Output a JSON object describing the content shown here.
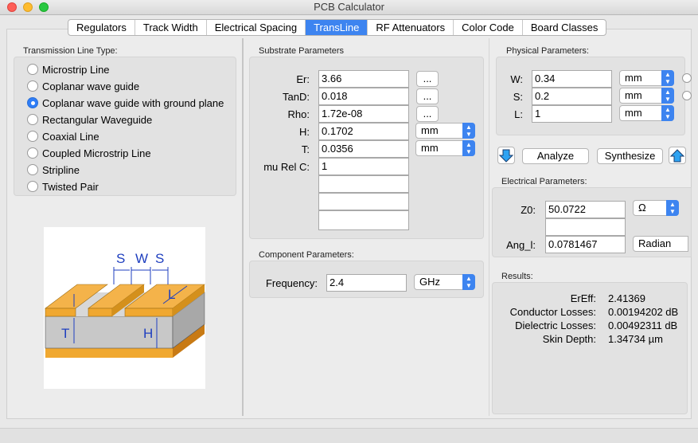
{
  "window": {
    "title": "PCB Calculator"
  },
  "tabs": [
    "Regulators",
    "Track Width",
    "Electrical Spacing",
    "TransLine",
    "RF Attenuators",
    "Color Code",
    "Board Classes"
  ],
  "active_tab": "TransLine",
  "line_type": {
    "title": "Transmission Line Type:",
    "options": [
      "Microstrip Line",
      "Coplanar wave guide",
      "Coplanar wave guide with ground plane",
      "Rectangular Waveguide",
      "Coaxial Line",
      "Coupled Microstrip Line",
      "Stripline",
      "Twisted Pair"
    ],
    "selected": "Coplanar wave guide with ground plane"
  },
  "diagram": {
    "label_s1": "S",
    "label_w": "W",
    "label_s2": "S",
    "label_l": "L",
    "label_t": "T",
    "label_h": "H"
  },
  "substrate": {
    "title": "Substrate Parameters",
    "er": {
      "label": "Er:",
      "value": "3.66",
      "button": "..."
    },
    "tand": {
      "label": "TanD:",
      "value": "0.018",
      "button": "..."
    },
    "rho": {
      "label": "Rho:",
      "value": "1.72e-08",
      "button": "..."
    },
    "h": {
      "label": "H:",
      "value": "0.1702",
      "unit": "mm"
    },
    "t": {
      "label": "T:",
      "value": "0.0356",
      "unit": "mm"
    },
    "murelc": {
      "label": "mu Rel C:",
      "value": "1"
    }
  },
  "component": {
    "title": "Component Parameters:",
    "frequency": {
      "label": "Frequency:",
      "value": "2.4",
      "unit": "GHz"
    }
  },
  "physical": {
    "title": "Physical Parameters:",
    "w": {
      "label": "W:",
      "value": "0.34",
      "unit": "mm"
    },
    "s": {
      "label": "S:",
      "value": "0.2",
      "unit": "mm"
    },
    "l": {
      "label": "L:",
      "value": "1",
      "unit": "mm"
    }
  },
  "actions": {
    "analyze": "Analyze",
    "synthesize": "Synthesize"
  },
  "electrical": {
    "title": "Electrical Parameters:",
    "z0": {
      "label": "Z0:",
      "value": "50.0722",
      "unit": "Ω"
    },
    "ang": {
      "label": "Ang_l:",
      "value": "0.0781467",
      "unit": "Radian"
    }
  },
  "results": {
    "title": "Results:",
    "rows": [
      {
        "label": "ErEff:",
        "value": "2.41369"
      },
      {
        "label": "Conductor Losses:",
        "value": "0.00194202 dB"
      },
      {
        "label": "Dielectric Losses:",
        "value": "0.00492311 dB"
      },
      {
        "label": "Skin Depth:",
        "value": "1.34734 µm"
      }
    ]
  },
  "colors": {
    "accent": "#3d84f0",
    "copper": "#f0a830",
    "substrate": "#c8c8c8"
  }
}
